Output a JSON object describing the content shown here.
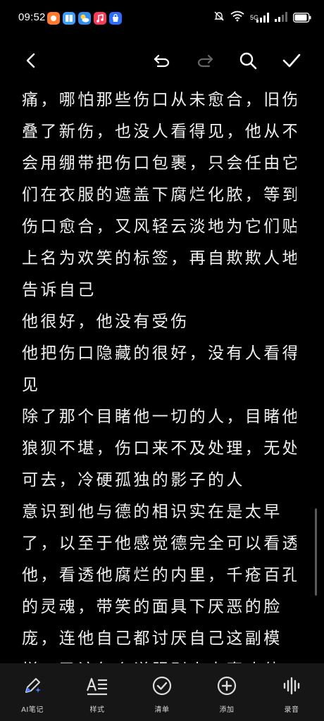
{
  "status_bar": {
    "time": "09:52",
    "network_label": "5G",
    "battery_label": "89"
  },
  "toolbar": {
    "back_icon": "chevron-left-icon",
    "undo_icon": "undo-icon",
    "redo_icon": "redo-icon",
    "search_icon": "search-icon",
    "done_icon": "checkmark-icon"
  },
  "note": {
    "lines": [
      "痛，哪怕那些伤口从未愈合，旧伤",
      "叠了新伤，也没人看得见，他从不",
      "会用绷带把伤口包裹，只会任由它",
      "们在衣服的遮盖下腐烂化脓，等到",
      "伤口愈合，又风轻云淡地为它们贴",
      "上名为欢笑的标签，再自欺欺人地",
      "告诉自己",
      "他很好，他没有受伤",
      "他把伤口隐藏的很好，没有人看得",
      "见",
      "除了那个目睹他一切的人，目睹他",
      "狼狈不堪，伤口来不及处理，无处",
      "可去，冷硬孤独的影子的人",
      "意识到他与德的相识实在是太早",
      "了，以至于他感觉德完全可以看透",
      "他，看透他腐烂的内里，千疮百孔",
      "的灵魂，带笑的面具下厌恶的脸",
      "庞，连他自己都讨厌自己这副模",
      "样，又该怎么说服别人去喜欢他"
    ]
  },
  "bottom_nav": {
    "items": [
      {
        "label": "AI笔记",
        "icon": "ai-pen-icon"
      },
      {
        "label": "样式",
        "icon": "text-style-icon"
      },
      {
        "label": "清单",
        "icon": "checklist-icon"
      },
      {
        "label": "添加",
        "icon": "add-circle-icon"
      },
      {
        "label": "录音",
        "icon": "audio-wave-icon"
      }
    ]
  },
  "colors": {
    "background": "#000000",
    "text": "#f0f0f0",
    "nav_background": "#161616",
    "accent_blue": "#4a7bff"
  }
}
